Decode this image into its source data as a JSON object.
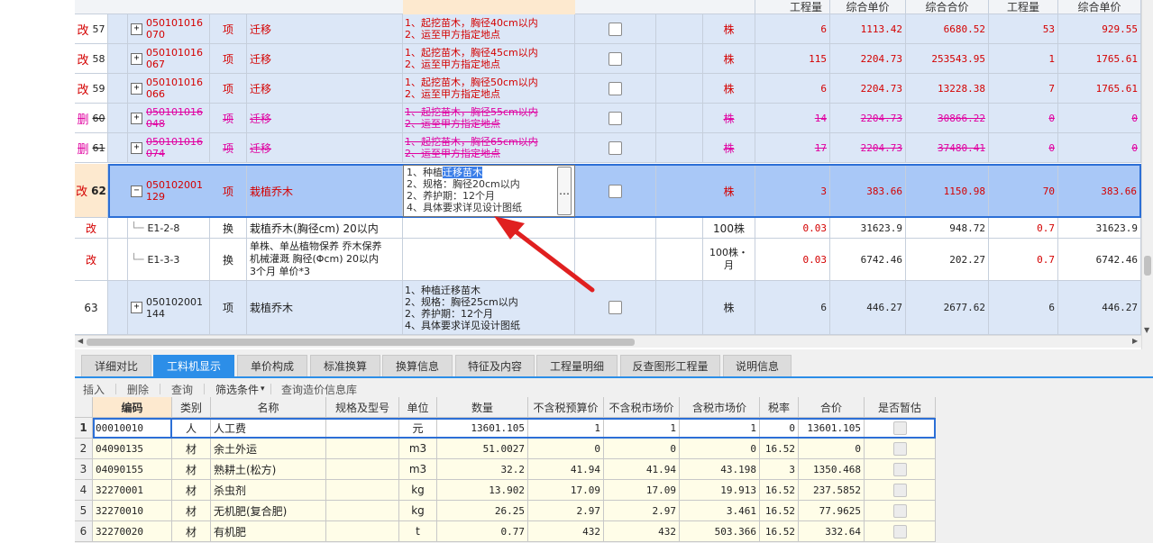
{
  "top_header": {
    "gcl1": "工程量",
    "zhdj1": "综合单价",
    "zhhj": "综合合价",
    "gcl2": "工程量",
    "zhdj2": "综合单价"
  },
  "rows": [
    {
      "mark": "改",
      "idx": "57",
      "code": "050101016070",
      "type": "项",
      "name": "迁移",
      "desc": [
        "1、起挖苗木，胸径40cm以内",
        "2、运至甲方指定地点"
      ],
      "unit": "株",
      "qty": "6",
      "price": "1113.42",
      "total": "6680.52",
      "qty2": "53",
      "price2": "929.55"
    },
    {
      "mark": "改",
      "idx": "58",
      "code": "050101016067",
      "type": "项",
      "name": "迁移",
      "desc": [
        "1、起挖苗木，胸径45cm以内",
        "2、运至甲方指定地点"
      ],
      "unit": "株",
      "qty": "115",
      "price": "2204.73",
      "total": "253543.95",
      "qty2": "1",
      "price2": "1765.61"
    },
    {
      "mark": "改",
      "idx": "59",
      "code": "050101016066",
      "type": "项",
      "name": "迁移",
      "desc": [
        "1、起挖苗木，胸径50cm以内",
        "2、运至甲方指定地点"
      ],
      "unit": "株",
      "qty": "6",
      "price": "2204.73",
      "total": "13228.38",
      "qty2": "7",
      "price2": "1765.61"
    },
    {
      "mark": "删",
      "idx": "60",
      "code": "050101016048",
      "type": "项",
      "name": "迁移",
      "desc": [
        "1、起挖苗木，胸径55cm以内",
        "2、运至甲方指定地点"
      ],
      "unit": "株",
      "qty": "14",
      "price": "2204.73",
      "total": "30866.22",
      "qty2": "0",
      "price2": "0"
    },
    {
      "mark": "删",
      "idx": "61",
      "code": "050101016074",
      "type": "项",
      "name": "迁移",
      "desc": [
        "1、起挖苗木，胸径65cm以内",
        "2、运至甲方指定地点"
      ],
      "unit": "株",
      "qty": "17",
      "price": "2204.73",
      "total": "37480.41",
      "qty2": "0",
      "price2": "0"
    }
  ],
  "selected_row": {
    "mark": "改",
    "idx": "62",
    "code": "050102001129",
    "type": "项",
    "name": "栽植乔木",
    "desc": [
      "1、种植",
      "迁移苗木",
      "2、规格：胸径20cm以内",
      "2、养护期：12个月",
      "4、具体要求详见设计图纸"
    ],
    "ellipsis": "…",
    "unit": "株",
    "qty": "3",
    "price": "383.66",
    "total": "1150.98",
    "qty2": "70",
    "price2": "383.66"
  },
  "sub_rows": [
    {
      "mark": "改",
      "code": "E1-2-8",
      "type": "换",
      "name": "栽植乔木(胸径cm) 20以内",
      "unit": "100株",
      "qty": "0.03",
      "price": "31623.9",
      "total": "948.72",
      "qty2": "0.7",
      "price2": "31623.9"
    },
    {
      "mark": "改",
      "code": "E1-3-3",
      "type": "换",
      "name_lines": [
        "单株、单丛植物保养 乔木保养",
        "机械灌溉 胸径(Φcm) 20以内",
        " 3个月 单价*3"
      ],
      "unit_lines": [
        "100株・",
        "月"
      ],
      "qty": "0.03",
      "price": "6742.46",
      "total": "202.27",
      "qty2": "0.7",
      "price2": "6742.46"
    }
  ],
  "row63": {
    "idx": "63",
    "code": "050102001144",
    "type": "项",
    "name": "栽植乔木",
    "desc": [
      "1、种植迁移苗木",
      "2、规格：胸径25cm以内",
      "2、养护期：12个月",
      "4、具体要求详见设计图纸"
    ],
    "unit": "株",
    "qty": "6",
    "price": "446.27",
    "total": "2677.62",
    "qty2": "6",
    "price2": "446.27"
  },
  "tabs": [
    "详细对比",
    "工料机显示",
    "单价构成",
    "标准换算",
    "换算信息",
    "特征及内容",
    "工程量明细",
    "反查图形工程量",
    "说明信息"
  ],
  "active_tab": "工料机显示",
  "toolbar": {
    "insert": "插入",
    "delete": "删除",
    "query": "查询",
    "filter": "筛选条件",
    "filter_arrow": "▾",
    "query_price": "查询造价信息库"
  },
  "bottom_headers": [
    "编码",
    "类别",
    "名称",
    "规格及型号",
    "单位",
    "数量",
    "不含税预算价",
    "不含税市场价",
    "含税市场价",
    "税率",
    "合价",
    "是否暂估"
  ],
  "bottom_rows": [
    {
      "n": "1",
      "code": "00010010",
      "cat": "人",
      "name": "人工费",
      "spec": "",
      "unit": "元",
      "qty": "13601.105",
      "p1": "1",
      "p2": "1",
      "p3": "1",
      "tax": "0",
      "total": "13601.105"
    },
    {
      "n": "2",
      "code": "04090135",
      "cat": "材",
      "name": "余土外运",
      "spec": "",
      "unit": "m3",
      "qty": "51.0027",
      "p1": "0",
      "p2": "0",
      "p3": "0",
      "tax": "16.52",
      "total": "0"
    },
    {
      "n": "3",
      "code": "04090155",
      "cat": "材",
      "name": "熟耕土(松方)",
      "spec": "",
      "unit": "m3",
      "qty": "32.2",
      "p1": "41.94",
      "p2": "41.94",
      "p3": "43.198",
      "tax": "3",
      "total": "1350.468"
    },
    {
      "n": "4",
      "code": "32270001",
      "cat": "材",
      "name": "杀虫剂",
      "spec": "",
      "unit": "kg",
      "qty": "13.902",
      "p1": "17.09",
      "p2": "17.09",
      "p3": "19.913",
      "tax": "16.52",
      "total": "237.5852"
    },
    {
      "n": "5",
      "code": "32270010",
      "cat": "材",
      "name": "无机肥(复合肥)",
      "spec": "",
      "unit": "kg",
      "qty": "26.25",
      "p1": "2.97",
      "p2": "2.97",
      "p3": "3.461",
      "tax": "16.52",
      "total": "77.9625"
    },
    {
      "n": "6",
      "code": "32270020",
      "cat": "材",
      "name": "有机肥",
      "spec": "",
      "unit": "t",
      "qty": "0.77",
      "p1": "432",
      "p2": "432",
      "p3": "503.366",
      "tax": "16.52",
      "total": "332.64"
    }
  ],
  "colors": {
    "selected_row": "#a9c8f7",
    "row_bg": "#dce7f7",
    "accent_blue": "#2c8ee8",
    "red_text": "#d40000",
    "deleted_text": "#e000a0",
    "arrow": "#e02020",
    "yellow_bg": "#fffde8"
  }
}
